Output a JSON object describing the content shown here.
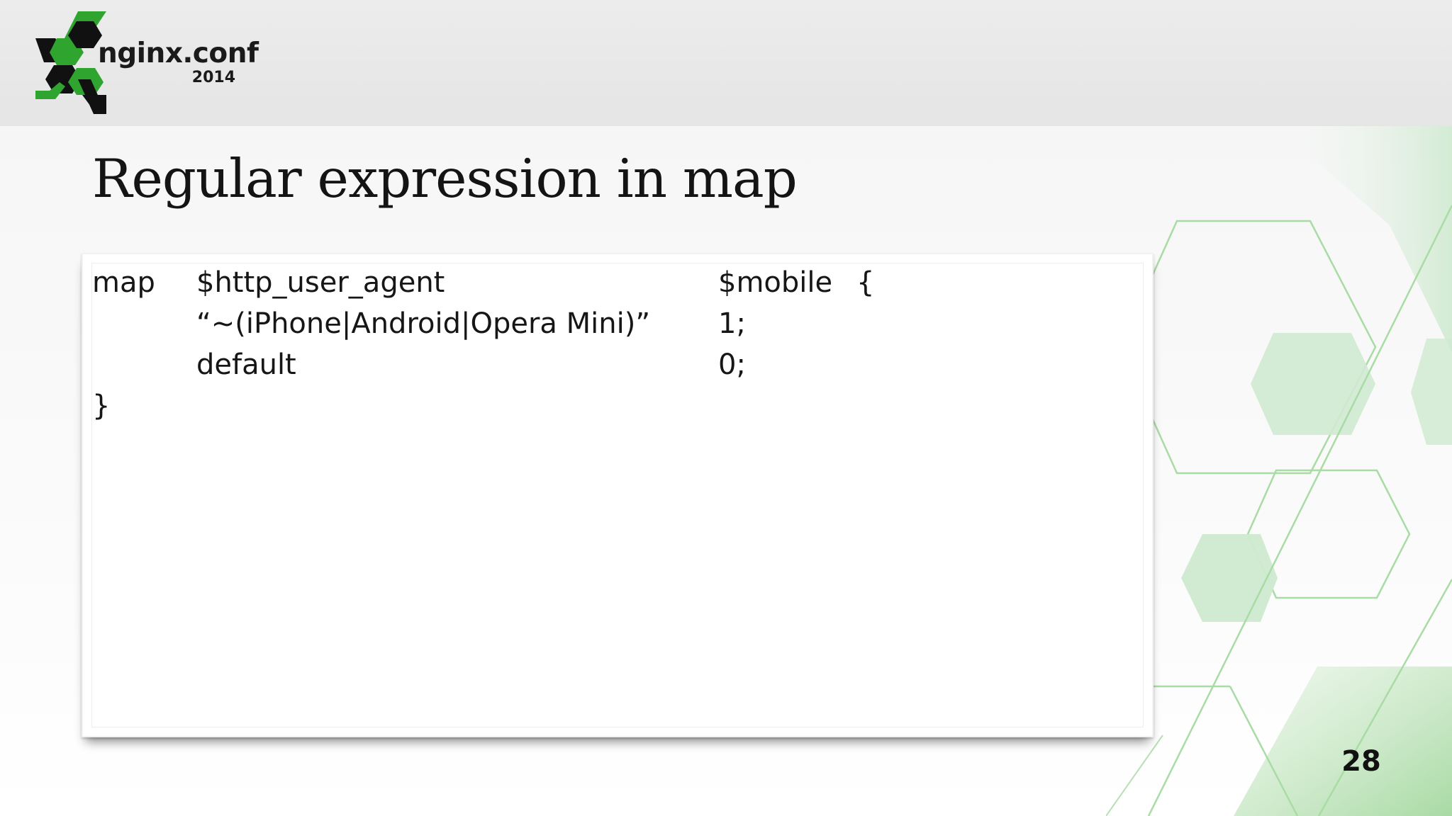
{
  "header": {
    "logo_name": "nginx.conf",
    "logo_year": "2014"
  },
  "slide": {
    "title": "Regular expression in map",
    "page_number": "28"
  },
  "code": {
    "lines": [
      {
        "c1": "map",
        "c2": "$http_user_agent",
        "c3": "$mobile",
        "c4": "{"
      },
      {
        "c1": "",
        "c2": "“~(iPhone|Android|Opera Mini)”",
        "c3": "1;",
        "c4": ""
      },
      {
        "c1": "",
        "c2": "default",
        "c3": "0;",
        "c4": ""
      },
      {
        "c1": "}",
        "c2": "",
        "c3": "",
        "c4": ""
      }
    ]
  },
  "colors": {
    "brand_green": "#2fa52f",
    "brand_black": "#111111",
    "decor_green": "#9fd69a"
  }
}
